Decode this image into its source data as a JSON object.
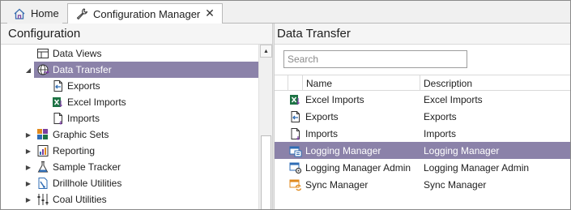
{
  "tabs": [
    {
      "label": "Home",
      "icon": "home-icon"
    },
    {
      "label": "Configuration Manager",
      "icon": "wrench-icon",
      "active": true
    }
  ],
  "left_pane": {
    "title": "Configuration",
    "tree": [
      {
        "label": "Data Views",
        "icon": "table-icon",
        "expander": ""
      },
      {
        "label": "Data Transfer",
        "icon": "globe-transfer-icon",
        "expander": "expanded",
        "selected": true
      },
      {
        "label": "Exports",
        "icon": "export-doc-icon",
        "expander": ""
      },
      {
        "label": "Excel Imports",
        "icon": "excel-icon",
        "expander": ""
      },
      {
        "label": "Imports",
        "icon": "import-doc-icon",
        "expander": ""
      },
      {
        "label": "Graphic Sets",
        "icon": "graphic-sets-icon",
        "expander": "collapsed"
      },
      {
        "label": "Reporting",
        "icon": "reporting-icon",
        "expander": "collapsed"
      },
      {
        "label": "Sample Tracker",
        "icon": "flask-icon",
        "expander": "collapsed"
      },
      {
        "label": "Drillhole Utilities",
        "icon": "drillhole-icon",
        "expander": "collapsed"
      },
      {
        "label": "Coal Utilities",
        "icon": "coal-icon",
        "expander": "collapsed"
      }
    ]
  },
  "right_pane": {
    "title": "Data Transfer",
    "search_placeholder": "Search",
    "columns": [
      "Name",
      "Description"
    ],
    "rows": [
      {
        "name": "Excel Imports",
        "description": "Excel Imports",
        "icon": "excel-icon"
      },
      {
        "name": "Exports",
        "description": "Exports",
        "icon": "export-doc-icon"
      },
      {
        "name": "Imports",
        "description": "Imports",
        "icon": "import-doc-icon"
      },
      {
        "name": "Logging Manager",
        "description": "Logging Manager",
        "icon": "logging-manager-icon",
        "selected": true
      },
      {
        "name": "Logging Manager Admin",
        "description": "Logging Manager Admin",
        "icon": "logging-admin-icon"
      },
      {
        "name": "Sync Manager",
        "description": "Sync Manager",
        "icon": "sync-manager-icon"
      }
    ]
  },
  "colors": {
    "selection": "#8b82a9",
    "excel_green": "#1d7344",
    "accent_purple": "#7a3fa0",
    "accent_blue": "#2f6db5",
    "accent_orange": "#e08a1e"
  }
}
